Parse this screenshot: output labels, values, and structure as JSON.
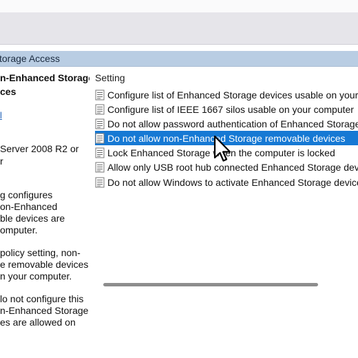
{
  "header": {
    "title": "torage Access"
  },
  "policy": {
    "title_lines": [
      "n-Enhanced Storage",
      "ces"
    ],
    "link": "l",
    "requirements": [
      "Server 2008 R2 or",
      "r"
    ],
    "description": [
      [
        "g configures",
        "on-Enhanced",
        "ble devices are",
        "omputer."
      ],
      [
        "policy setting, non-",
        "e removable devices",
        "n your computer."
      ],
      [
        "lo not configure this",
        "n-Enhanced Storage",
        "es are allowed on"
      ]
    ]
  },
  "settings": {
    "column_header": "Setting",
    "items": [
      {
        "label": "Configure list of Enhanced Storage devices usable on your co...",
        "selected": false
      },
      {
        "label": "Configure list of IEEE 1667 silos usable on your computer",
        "selected": false
      },
      {
        "label": "Do not allow password authentication of Enhanced Storage d...",
        "selected": false
      },
      {
        "label": "Do not allow non-Enhanced Storage removable devices",
        "selected": true
      },
      {
        "label": "Lock Enhanced Storage when the computer is locked",
        "selected": false
      },
      {
        "label": "Allow only USB root hub connected Enhanced Storage devices",
        "selected": false
      },
      {
        "label": "Do not allow Windows to activate Enhanced Storage devices",
        "selected": false
      }
    ]
  },
  "colors": {
    "accent": "#1679d4",
    "header_bg": "#b9cde3"
  },
  "icons": {
    "setting": "policy-setting-icon",
    "pointer": "mouse-pointer-icon"
  }
}
